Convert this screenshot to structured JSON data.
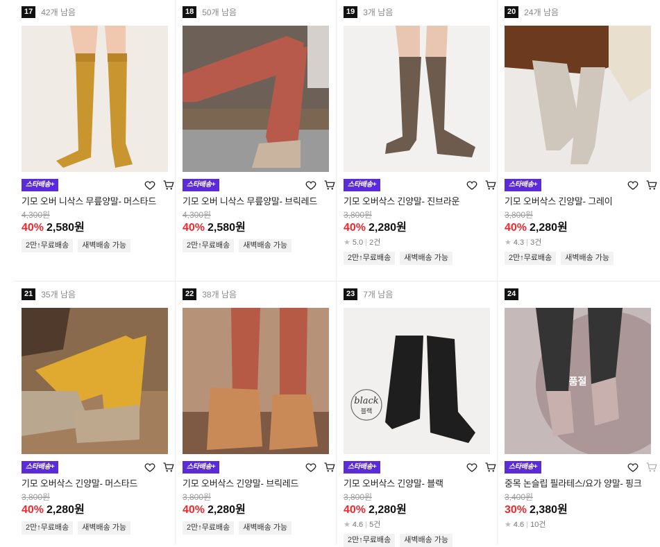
{
  "badge_label": "스타배송+",
  "products": [
    {
      "rank": "17",
      "stock": "42개 남음",
      "title": "기모 오버 니삭스 무릎양말- 머스타드",
      "orig": "4,300원",
      "pct": "40%",
      "price": "2,580원",
      "rating": null,
      "reviews": null,
      "tags": [
        "2만↑무료배송",
        "새벽배송 가능"
      ],
      "image": "mustard-overknee",
      "soldout": null
    },
    {
      "rank": "18",
      "stock": "50개 남음",
      "title": "기모 오버 니삭스 무릎양말- 브릭레드",
      "orig": "4,300원",
      "pct": "40%",
      "price": "2,580원",
      "rating": null,
      "reviews": null,
      "tags": [
        "2만↑무료배송",
        "새벽배송 가능"
      ],
      "image": "brick-overknee",
      "soldout": null
    },
    {
      "rank": "19",
      "stock": "3개 남음",
      "title": "기모 오버삭스 긴양말- 진브라운",
      "orig": "3,800원",
      "pct": "40%",
      "price": "2,280원",
      "rating": "5.0",
      "reviews": "2건",
      "tags": [
        "2만↑무료배송",
        "새벽배송 가능"
      ],
      "image": "brown-knee",
      "soldout": null
    },
    {
      "rank": "20",
      "stock": "24개 남음",
      "title": "기모 오버삭스 긴양말- 그레이",
      "orig": "3,800원",
      "pct": "40%",
      "price": "2,280원",
      "rating": "4.3",
      "reviews": "3건",
      "tags": [
        "2만↑무료배송",
        "새벽배송 가능"
      ],
      "image": "grey-knee",
      "soldout": null
    },
    {
      "rank": "21",
      "stock": "35개 남음",
      "title": "기모 오버삭스 긴양말- 머스타드",
      "orig": "3,800원",
      "pct": "40%",
      "price": "2,280원",
      "rating": null,
      "reviews": null,
      "tags": [
        "2만↑무료배송",
        "새벽배송 가능"
      ],
      "image": "mustard-knee",
      "soldout": null
    },
    {
      "rank": "22",
      "stock": "38개 남음",
      "title": "기모 오버삭스 긴양말- 브릭레드",
      "orig": "3,800원",
      "pct": "40%",
      "price": "2,280원",
      "rating": null,
      "reviews": null,
      "tags": [
        "2만↑무료배송",
        "새벽배송 가능"
      ],
      "image": "brick-knee",
      "soldout": null
    },
    {
      "rank": "23",
      "stock": "7개 남음",
      "title": "기모 오버삭스 긴양말- 블랙",
      "orig": "3,800원",
      "pct": "40%",
      "price": "2,280원",
      "rating": "4.6",
      "reviews": "5건",
      "tags": [
        "2만↑무료배송",
        "새벽배송 가능"
      ],
      "image": "black-knee",
      "soldout": null,
      "image_text": [
        "black",
        "블랙"
      ]
    },
    {
      "rank": "24",
      "stock": "",
      "title": "중목 논슬립 필라테스/요가 양말- 핑크",
      "orig": "3,400원",
      "pct": "30%",
      "price": "2,380원",
      "rating": "4.6",
      "reviews": "10건",
      "tags": [],
      "image": "pink-yoga",
      "soldout": "품절"
    }
  ],
  "colors": {
    "badge": "#5a2bd6",
    "discount": "#f0282d"
  }
}
